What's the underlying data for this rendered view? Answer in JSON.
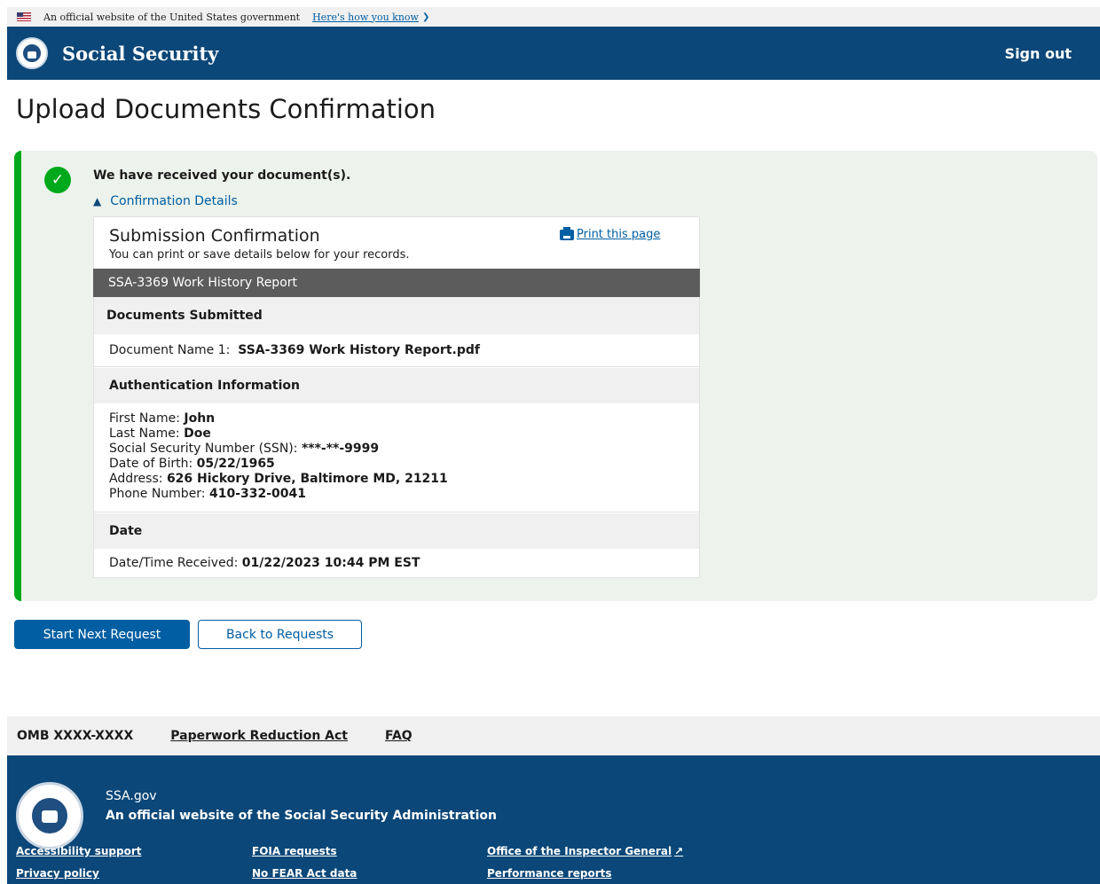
{
  "banner": {
    "text": "An official website of the United States government",
    "link": "Here's how you know"
  },
  "header": {
    "title": "Social Security",
    "sign_out": "Sign out"
  },
  "page": {
    "title": "Upload Documents Confirmation"
  },
  "alert": {
    "heading": "We have received your document(s).",
    "details_toggle": "Confirmation Details"
  },
  "card": {
    "title": "Submission Confirmation",
    "subtitle": "You can print or save details below for your records.",
    "print_link": "Print this page",
    "form_name": "SSA-3369 Work History Report",
    "documents": {
      "heading": "Documents Submitted",
      "label": "Document Name 1:",
      "value": "SSA-3369 Work History Report.pdf"
    },
    "auth": {
      "heading": "Authentication Information",
      "fields": [
        {
          "label": "First Name:",
          "value": "John"
        },
        {
          "label": "Last Name:",
          "value": "Doe"
        },
        {
          "label": "Social Security Number (SSN):",
          "value": "***-**-9999"
        },
        {
          "label": "Date of Birth:",
          "value": "05/22/1965"
        },
        {
          "label": "Address:",
          "value": "626 Hickory Drive, Baltimore MD, 21211"
        },
        {
          "label": "Phone Number:",
          "value": "410-332-0041"
        }
      ]
    },
    "date": {
      "heading": "Date",
      "label": "Date/Time Received:",
      "value": "01/22/2023 10:44 PM EST"
    }
  },
  "buttons": {
    "primary": "Start Next Request",
    "secondary": "Back to Requests"
  },
  "footer": {
    "omb": "OMB XXXX-XXXX",
    "paperwork": "Paperwork Reduction Act",
    "faq": "FAQ",
    "site": "SSA.gov",
    "official": "An official website of the Social Security Administration",
    "links": {
      "accessibility": "Accessibility support",
      "privacy": "Privacy policy",
      "foia": "FOIA requests",
      "nofear": "No FEAR Act data",
      "oig": "Office of the Inspector General",
      "performance": "Performance reports"
    }
  },
  "colors": {
    "header_bg": "#0b4778",
    "link": "#005ea2",
    "success": "#00a91c",
    "alert_bg": "#ecf3ec",
    "form_band": "#5c5c5c"
  },
  "icons": [
    "us-flag-icon",
    "chevron-down-icon",
    "ssa-seal-icon",
    "check-circle-icon",
    "chevron-up-icon",
    "printer-icon",
    "external-link-icon"
  ]
}
